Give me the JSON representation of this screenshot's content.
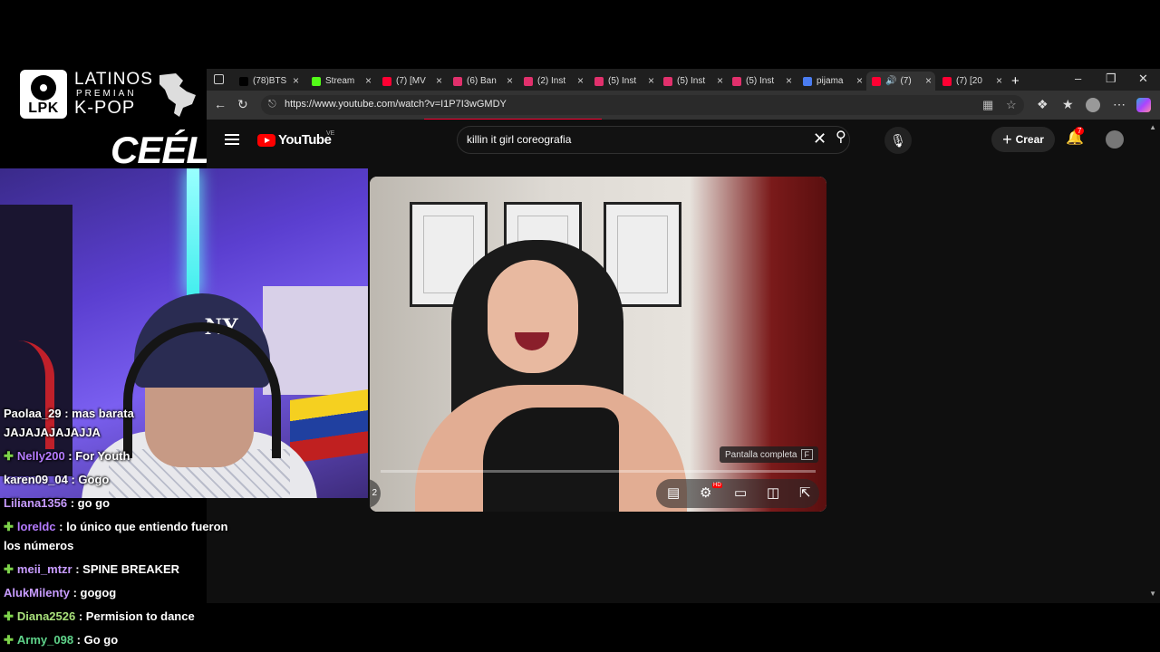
{
  "overlay": {
    "logo_badge": "LPK",
    "logo_line1": "LATINOS",
    "logo_line2": "PREMIAN",
    "logo_line3": "K-POP",
    "streamer_name": "CEÉLE"
  },
  "browser": {
    "tabs": [
      {
        "label": "(78)BTS",
        "icon": "tiktok-icon",
        "color": "#000000"
      },
      {
        "label": "Stream",
        "icon": "kick-icon",
        "color": "#53fc18"
      },
      {
        "label": "(7) [MV",
        "icon": "youtube-icon",
        "color": "#ff0033"
      },
      {
        "label": "(6) Ban",
        "icon": "instagram-icon",
        "color": "#e1306c"
      },
      {
        "label": "(2) Inst",
        "icon": "instagram-icon",
        "color": "#e1306c"
      },
      {
        "label": "(5) Inst",
        "icon": "instagram-icon",
        "color": "#e1306c"
      },
      {
        "label": "(5) Inst",
        "icon": "instagram-icon",
        "color": "#e1306c"
      },
      {
        "label": "(5) Inst",
        "icon": "instagram-icon",
        "color": "#e1306c"
      },
      {
        "label": "pijama",
        "icon": "gemini-icon",
        "color": "#4a7cf0"
      },
      {
        "label": "(7)",
        "icon": "youtube-icon",
        "color": "#ff0033",
        "active": true
      },
      {
        "label": "(7) [20",
        "icon": "youtube-icon",
        "color": "#ff0033"
      }
    ],
    "new_tab": "+",
    "url": "https://www.youtube.com/watch?v=I1P7I3wGMDY"
  },
  "youtube": {
    "logo_text": "YouTube",
    "region": "VE",
    "search_value": "killin it girl coreografia",
    "create_label": "Crear",
    "notification_count": "7",
    "fullscreen_tooltip": "Pantalla completa",
    "fullscreen_key": "F",
    "left_control_text": "2"
  },
  "chat": [
    {
      "user": "Paolaa_29",
      "text": " : mas barata",
      "user_color": "#ffffff",
      "gem": false
    },
    {
      "user": "",
      "text": "JAJAJAJAJAJJA",
      "user_color": "#ffffff",
      "gem": false
    },
    {
      "user": "Nelly200",
      "text": " : For Youth",
      "user_color": "#b57bff",
      "gem": true
    },
    {
      "user": "karen09_04",
      "text": " : Gogo",
      "user_color": "#ffffff",
      "gem": false
    },
    {
      "user": "Liliana1356",
      "text": " : go go",
      "user_color": "#c89cff",
      "gem": false
    },
    {
      "user": "loreldc",
      "text": " : lo único que entiendo fueron",
      "user_color": "#b57bff",
      "gem": true
    },
    {
      "user": "",
      "text": "los números",
      "user_color": "#ffffff",
      "gem": false
    },
    {
      "user": "meii_mtzr",
      "text": " : SPINE BREAKER",
      "user_color": "#c89cff",
      "gem": true
    },
    {
      "user": "AlukMilenty",
      "text": " : gogog",
      "user_color": "#c89cff",
      "gem": false
    },
    {
      "user": "Diana2526",
      "text": " : Permision to dance",
      "user_color": "#a8e07a",
      "gem": true
    },
    {
      "user": "Army_098",
      "text": " : Go go",
      "user_color": "#5fd38a",
      "gem": true
    }
  ],
  "colors": {
    "youtube_red": "#ff0000",
    "chat_gem": "#7dd34a"
  }
}
